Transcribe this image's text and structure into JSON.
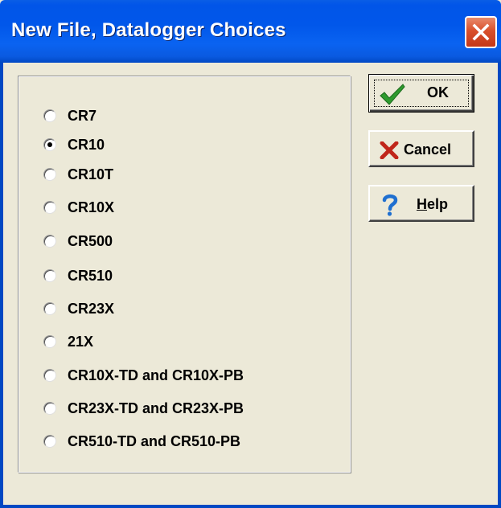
{
  "window": {
    "title": "New File, Datalogger Choices",
    "close_icon": "close-icon"
  },
  "datalogger_options": {
    "selected": "CR10",
    "items": [
      {
        "label": "CR7",
        "checked": false
      },
      {
        "label": "CR10",
        "checked": true
      },
      {
        "label": "CR10T",
        "checked": false
      },
      {
        "label": "CR10X",
        "checked": false
      },
      {
        "label": "CR500",
        "checked": false
      },
      {
        "label": "CR510",
        "checked": false
      },
      {
        "label": "CR23X",
        "checked": false
      },
      {
        "label": "21X",
        "checked": false
      },
      {
        "label": "CR10X-TD and CR10X-PB",
        "checked": false
      },
      {
        "label": "CR23X-TD and CR23X-PB",
        "checked": false
      },
      {
        "label": "CR510-TD and CR510-PB",
        "checked": false
      }
    ]
  },
  "buttons": {
    "ok": {
      "label": "OK",
      "icon": "checkmark-icon",
      "icon_color": "#2e9a2e"
    },
    "cancel": {
      "label": "Cancel",
      "icon": "x-icon",
      "icon_color": "#c0261a"
    },
    "help": {
      "label_prefix": "H",
      "label_rest": "elp",
      "icon": "question-mark-icon",
      "icon_color": "#1f6fd0"
    }
  },
  "colors": {
    "titlebar": "#0157ea",
    "window_face": "#ece9d8",
    "close_button": "#d9502b"
  }
}
